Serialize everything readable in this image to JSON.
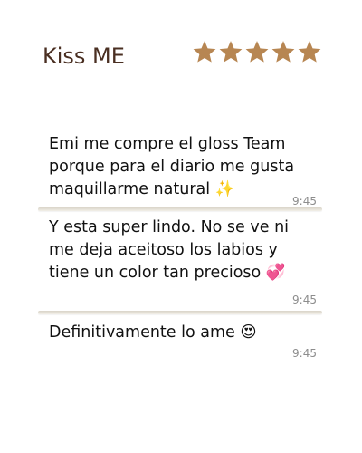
{
  "header": {
    "title": "Kiss ME",
    "rating": 5,
    "star_color": "#b78652"
  },
  "messages": [
    {
      "text": "Emi me compre el gloss Team porque para el diario me gusta maquillarme natural ✨",
      "time": "9:45"
    },
    {
      "text": "Y esta super lindo. No se ve ni me deja aceitoso los labios y tiene un color tan precioso 💞",
      "time": "9:45"
    },
    {
      "text": "Definitivamente lo ame 😍",
      "time": "9:45"
    }
  ]
}
